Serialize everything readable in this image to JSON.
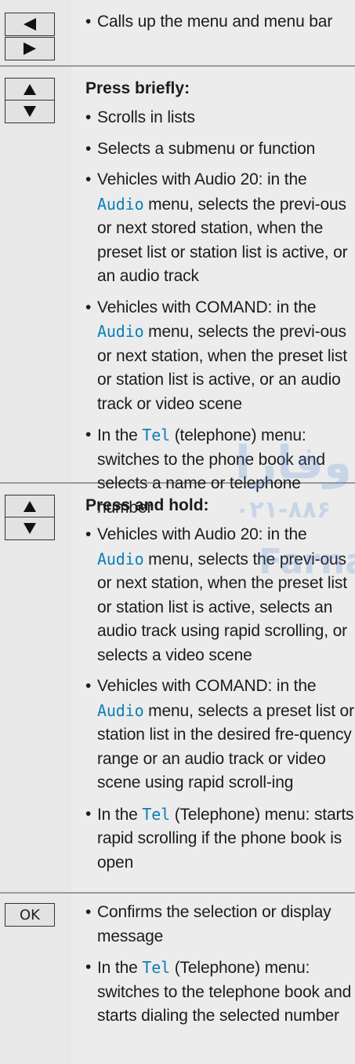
{
  "rows": [
    {
      "keys": [
        "left",
        "right"
      ],
      "items": [
        {
          "text": "Calls up the menu and menu bar"
        }
      ]
    },
    {
      "keys": [
        "up",
        "down"
      ],
      "heading": "Press briefly:",
      "items": [
        {
          "text": "Scrolls in lists"
        },
        {
          "text": "Selects a submenu or function"
        },
        {
          "pre": "Vehicles with Audio 20: in the ",
          "kw": "Audio",
          "post": " menu, selects the previ-ous or next stored station, when the preset list or station list is active, or an audio track"
        },
        {
          "pre": "Vehicles with COMAND: in the ",
          "kw": "Audio",
          "post": " menu, selects the previ-ous or next station, when the preset list or station list is active, or an audio track or video scene"
        },
        {
          "pre": "In the ",
          "kw": "Tel",
          "post": " (telephone) menu: switches to the phone book and selects a name or telephone number"
        }
      ]
    },
    {
      "keys": [
        "up",
        "down"
      ],
      "heading": "Press and hold:",
      "items": [
        {
          "pre": "Vehicles with Audio 20: in the ",
          "kw": "Audio",
          "post": " menu, selects the previ-ous or next station, when the preset list or station list is active, selects an audio track using rapid scrolling, or selects a video scene"
        },
        {
          "pre": "Vehicles with COMAND: in the ",
          "kw": "Audio",
          "post": " menu, selects a preset list or station list in the desired fre-quency range or an audio track or video scene using rapid scroll-ing"
        },
        {
          "pre": "In the ",
          "kw": "Tel",
          "post": " (Telephone) menu: starts rapid scrolling if the phone book is open"
        }
      ]
    },
    {
      "keys": [
        "ok"
      ],
      "key_label": "OK",
      "items": [
        {
          "text": "Confirms the selection or display message"
        },
        {
          "pre": "In the ",
          "kw": "Tel",
          "post": " (Telephone) menu: switches to the telephone book and starts dialing the selected number"
        }
      ]
    }
  ],
  "watermark": {
    "persian": "وفارا",
    "phone": "۰۲۱-۸۸۶",
    "latin": "Farna"
  }
}
